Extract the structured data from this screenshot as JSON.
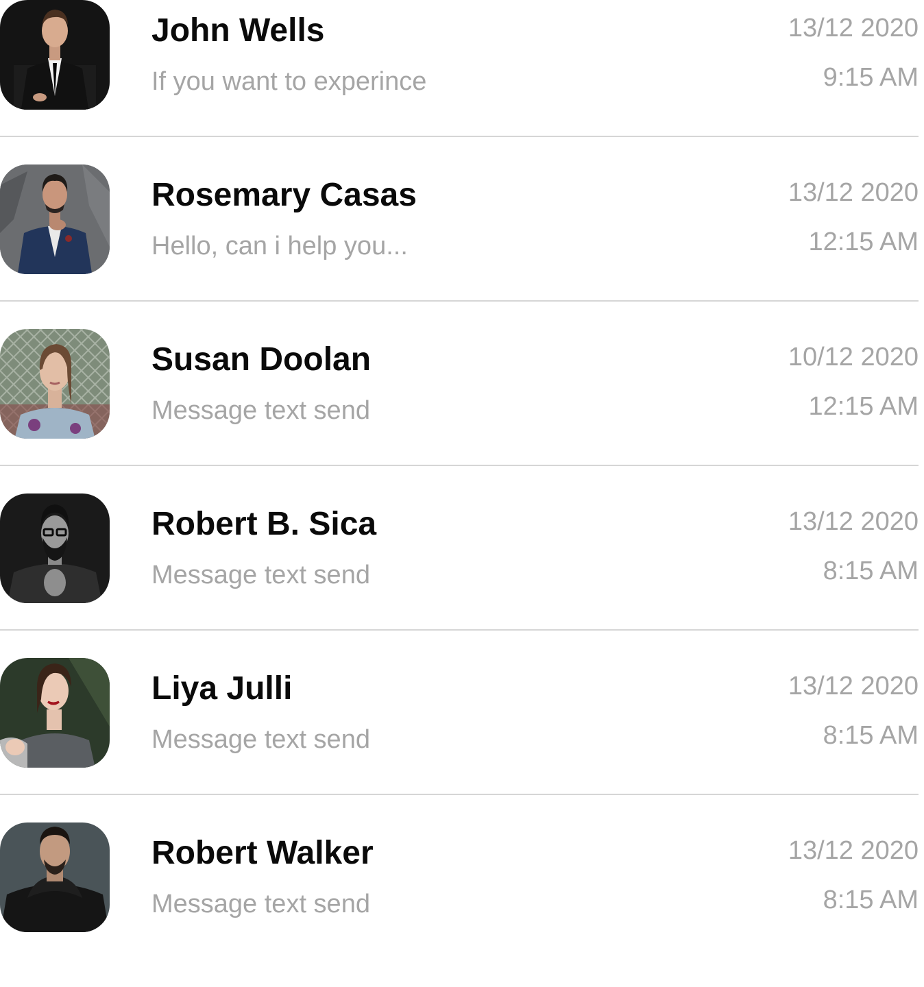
{
  "conversations": [
    {
      "name": "John Wells",
      "preview": "If you want to experince",
      "date": "13/12 2020",
      "time": "9:15 AM",
      "avatar_icon": "avatar-man-black-suit"
    },
    {
      "name": "Rosemary Casas",
      "preview": "Hello, can i help you...",
      "date": "13/12 2020",
      "time": "12:15 AM",
      "avatar_icon": "avatar-man-blue-suit"
    },
    {
      "name": "Susan Doolan",
      "preview": "Message text send",
      "date": "10/12 2020",
      "time": "12:15 AM",
      "avatar_icon": "avatar-woman-fence"
    },
    {
      "name": "Robert B. Sica",
      "preview": "Message text send",
      "date": "13/12 2020",
      "time": "8:15 AM",
      "avatar_icon": "avatar-man-glasses-beard"
    },
    {
      "name": "Liya Julli",
      "preview": "Message text send",
      "date": "13/12 2020",
      "time": "8:15 AM",
      "avatar_icon": "avatar-woman-red-lips"
    },
    {
      "name": "Robert Walker",
      "preview": "Message text send",
      "date": "13/12 2020",
      "time": "8:15 AM",
      "avatar_icon": "avatar-man-hoodie"
    }
  ],
  "colors": {
    "name_text": "#0a0a0a",
    "secondary_text": "#a5a5a5",
    "divider": "#d6d6d6",
    "background": "#ffffff"
  }
}
